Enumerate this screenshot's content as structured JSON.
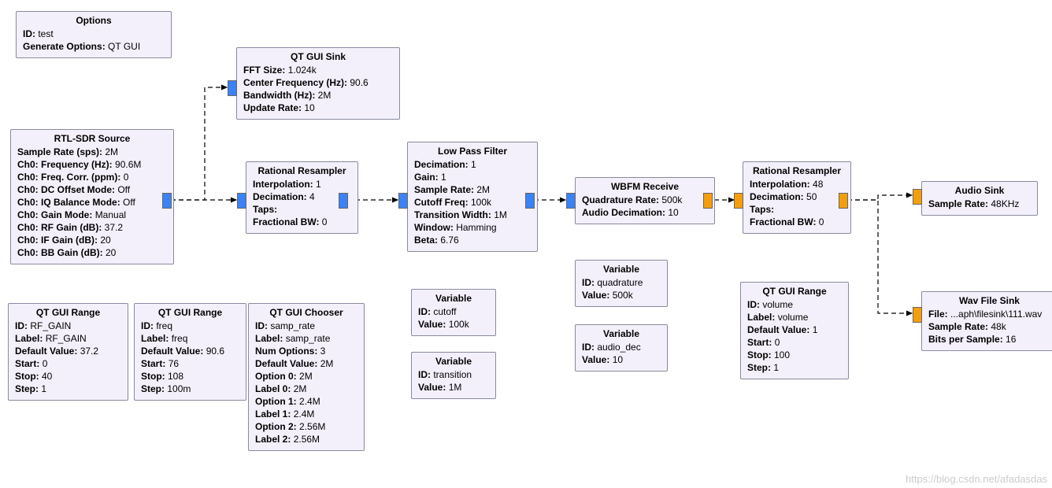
{
  "options": {
    "title": "Options",
    "l1k": "ID:",
    "l1v": "test",
    "l2k": "Generate Options:",
    "l2v": "QT GUI"
  },
  "rtl": {
    "title": "RTL-SDR Source",
    "rows": [
      [
        "Sample Rate (sps):",
        "2M"
      ],
      [
        "Ch0: Frequency (Hz):",
        "90.6M"
      ],
      [
        "Ch0: Freq. Corr. (ppm):",
        "0"
      ],
      [
        "Ch0: DC Offset Mode:",
        "Off"
      ],
      [
        "Ch0: IQ Balance Mode:",
        "Off"
      ],
      [
        "Ch0: Gain Mode:",
        "Manual"
      ],
      [
        "Ch0: RF Gain (dB):",
        "37.2"
      ],
      [
        "Ch0: IF Gain (dB):",
        "20"
      ],
      [
        "Ch0: BB Gain (dB):",
        "20"
      ]
    ]
  },
  "qtsink": {
    "title": "QT GUI Sink",
    "rows": [
      [
        "FFT Size:",
        "1.024k"
      ],
      [
        "Center Frequency (Hz):",
        "90.6"
      ],
      [
        "Bandwidth (Hz):",
        "2M"
      ],
      [
        "Update Rate:",
        "10"
      ]
    ]
  },
  "rr1": {
    "title": "Rational Resampler",
    "rows": [
      [
        "Interpolation:",
        "1"
      ],
      [
        "Decimation:",
        "4"
      ],
      [
        "Taps:",
        ""
      ],
      [
        "Fractional BW:",
        "0"
      ]
    ]
  },
  "lpf": {
    "title": "Low Pass Filter",
    "rows": [
      [
        "Decimation:",
        "1"
      ],
      [
        "Gain:",
        "1"
      ],
      [
        "Sample Rate:",
        "2M"
      ],
      [
        "Cutoff Freq:",
        "100k"
      ],
      [
        "Transition Width:",
        "1M"
      ],
      [
        "Window:",
        "Hamming"
      ],
      [
        "Beta:",
        "6.76"
      ]
    ]
  },
  "wbfm": {
    "title": "WBFM Receive",
    "rows": [
      [
        "Quadrature Rate:",
        "500k"
      ],
      [
        "Audio Decimation:",
        "10"
      ]
    ]
  },
  "rr2": {
    "title": "Rational Resampler",
    "rows": [
      [
        "Interpolation:",
        "48"
      ],
      [
        "Decimation:",
        "50"
      ],
      [
        "Taps:",
        ""
      ],
      [
        "Fractional BW:",
        "0"
      ]
    ]
  },
  "audio": {
    "title": "Audio Sink",
    "rows": [
      [
        "Sample Rate:",
        "48KHz"
      ]
    ]
  },
  "wav": {
    "title": "Wav File Sink",
    "rows": [
      [
        "File:",
        "...aph\\filesink\\111.wav"
      ],
      [
        "Sample Rate:",
        "48k"
      ],
      [
        "Bits per Sample:",
        "16"
      ]
    ]
  },
  "rng_rf": {
    "title": "QT GUI Range",
    "rows": [
      [
        "ID:",
        "RF_GAIN"
      ],
      [
        "Label:",
        "RF_GAIN"
      ],
      [
        "Default Value:",
        "37.2"
      ],
      [
        "Start:",
        "0"
      ],
      [
        "Stop:",
        "40"
      ],
      [
        "Step:",
        "1"
      ]
    ]
  },
  "rng_freq": {
    "title": "QT GUI Range",
    "rows": [
      [
        "ID:",
        "freq"
      ],
      [
        "Label:",
        "freq"
      ],
      [
        "Default Value:",
        "90.6"
      ],
      [
        "Start:",
        "76"
      ],
      [
        "Stop:",
        "108"
      ],
      [
        "Step:",
        "100m"
      ]
    ]
  },
  "chooser": {
    "title": "QT GUI Chooser",
    "rows": [
      [
        "ID:",
        "samp_rate"
      ],
      [
        "Label:",
        "samp_rate"
      ],
      [
        "Num Options:",
        "3"
      ],
      [
        "Default Value:",
        "2M"
      ],
      [
        "Option 0:",
        "2M"
      ],
      [
        "Label 0:",
        "2M"
      ],
      [
        "Option 1:",
        "2.4M"
      ],
      [
        "Label 1:",
        "2.4M"
      ],
      [
        "Option 2:",
        "2.56M"
      ],
      [
        "Label 2:",
        "2.56M"
      ]
    ]
  },
  "var_cut": {
    "title": "Variable",
    "rows": [
      [
        "ID:",
        "cutoff"
      ],
      [
        "Value:",
        "100k"
      ]
    ]
  },
  "var_tr": {
    "title": "Variable",
    "rows": [
      [
        "ID:",
        "transition"
      ],
      [
        "Value:",
        "1M"
      ]
    ]
  },
  "var_q": {
    "title": "Variable",
    "rows": [
      [
        "ID:",
        "quadrature"
      ],
      [
        "Value:",
        "500k"
      ]
    ]
  },
  "var_ad": {
    "title": "Variable",
    "rows": [
      [
        "ID:",
        "audio_dec"
      ],
      [
        "Value:",
        "10"
      ]
    ]
  },
  "rng_vol": {
    "title": "QT GUI Range",
    "rows": [
      [
        "ID:",
        "volume"
      ],
      [
        "Label:",
        "volume"
      ],
      [
        "Default Value:",
        "1"
      ],
      [
        "Start:",
        "0"
      ],
      [
        "Stop:",
        "100"
      ],
      [
        "Step:",
        "1"
      ]
    ]
  },
  "watermark": "https://blog.csdn.net/afadasdas"
}
